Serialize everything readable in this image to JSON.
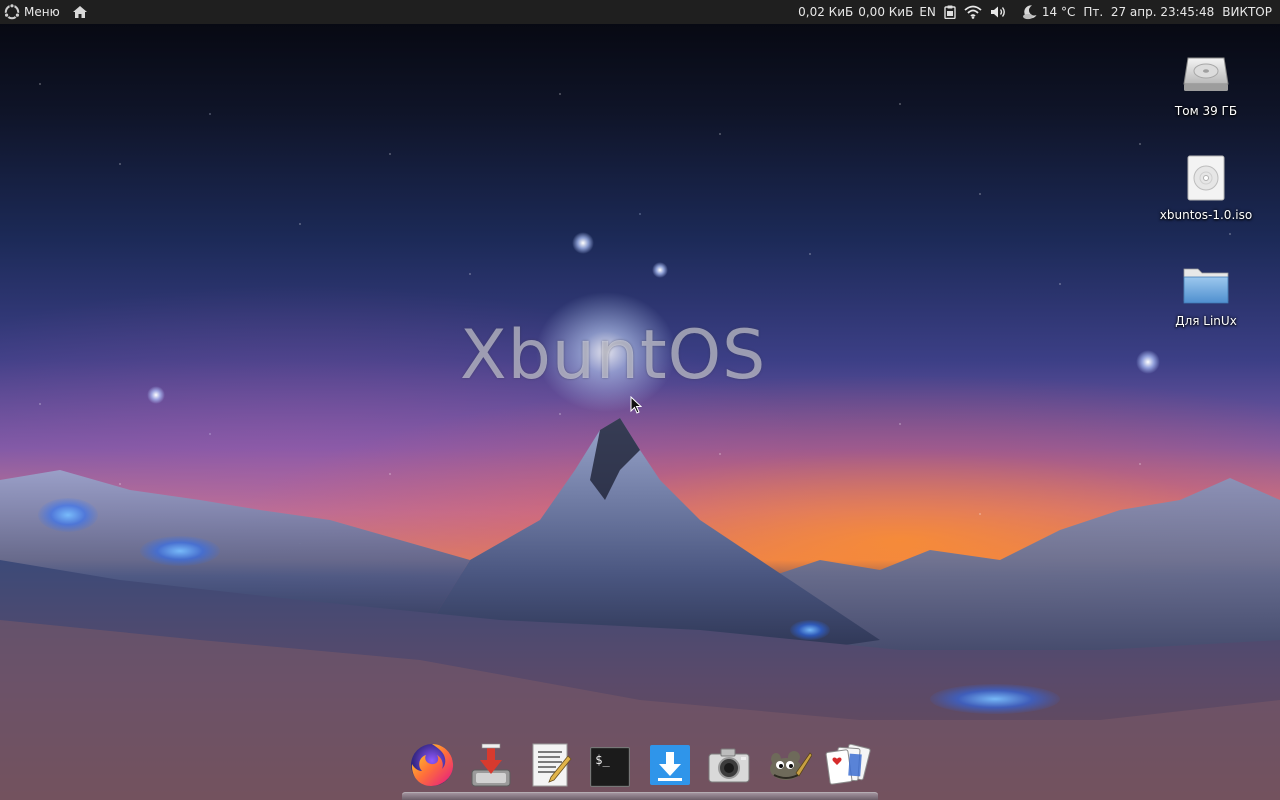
{
  "top_panel": {
    "menu_label": "Меню",
    "net_down": "0,02 КиБ",
    "net_up": "0,00 КиБ",
    "keyboard_layout": "EN",
    "weather": "14 °C",
    "datetime": "Пт.  27 апр. 23:45:48",
    "user": "ВИКТОР",
    "icons": [
      "ubuntu-logo-icon",
      "home-icon",
      "clipboard-icon",
      "wifi-icon",
      "volume-icon",
      "weather-night-icon"
    ]
  },
  "wallpaper": {
    "logo_text": "XbuntOS"
  },
  "desktop_icons": [
    {
      "label": "Том 39 ГБ",
      "icon": "drive-icon"
    },
    {
      "label": "xbuntos-1.0.iso",
      "icon": "disc-image-icon"
    },
    {
      "label": "Для LinUx",
      "icon": "folder-icon"
    }
  ],
  "dock": {
    "items": [
      {
        "name": "firefox",
        "icon": "firefox-icon"
      },
      {
        "name": "installer",
        "icon": "install-icon"
      },
      {
        "name": "text-editor",
        "icon": "text-editor-icon"
      },
      {
        "name": "terminal",
        "icon": "terminal-icon",
        "glyph": "$_"
      },
      {
        "name": "downloader",
        "icon": "download-icon"
      },
      {
        "name": "screenshot",
        "icon": "camera-icon"
      },
      {
        "name": "gimp",
        "icon": "gimp-icon"
      },
      {
        "name": "solitaire",
        "icon": "cards-icon"
      }
    ]
  },
  "colors": {
    "panel_bg": "#1f1f1f",
    "panel_text": "#e8e8e8",
    "folder_blue": "#6fa8dc"
  }
}
